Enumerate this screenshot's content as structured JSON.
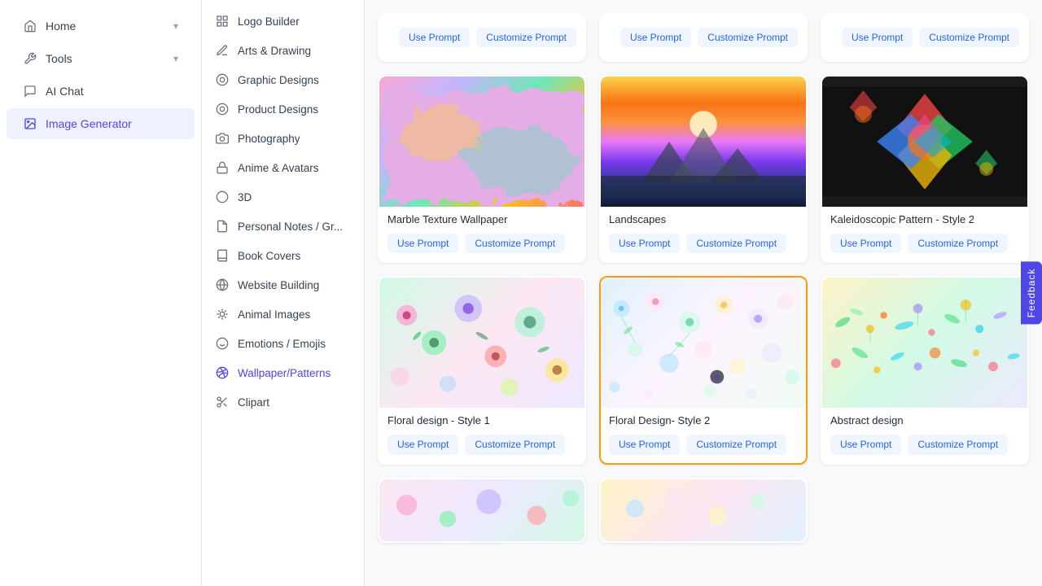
{
  "sidebar": {
    "items": [
      {
        "id": "home",
        "label": "Home",
        "icon": "home",
        "hasChevron": true,
        "active": false
      },
      {
        "id": "tools",
        "label": "Tools",
        "icon": "tools",
        "hasChevron": true,
        "active": false
      },
      {
        "id": "ai-chat",
        "label": "AI Chat",
        "icon": "chat",
        "hasChevron": false,
        "active": false
      },
      {
        "id": "image-generator",
        "label": "Image Generator",
        "icon": "image",
        "hasChevron": false,
        "active": true
      }
    ]
  },
  "categories": [
    {
      "id": "logo-builder",
      "label": "Logo Builder",
      "icon": "grid",
      "active": false
    },
    {
      "id": "arts-drawing",
      "label": "Arts & Drawing",
      "icon": "pencil",
      "active": false
    },
    {
      "id": "graphic-designs",
      "label": "Graphic Designs",
      "icon": "shapes",
      "active": false
    },
    {
      "id": "product-designs",
      "label": "Product Designs",
      "icon": "shapes",
      "active": false
    },
    {
      "id": "photography",
      "label": "Photography",
      "icon": "camera",
      "active": false
    },
    {
      "id": "anime-avatars",
      "label": "Anime & Avatars",
      "icon": "lock",
      "active": false
    },
    {
      "id": "3d",
      "label": "3D",
      "icon": "sphere",
      "active": false
    },
    {
      "id": "personal-notes",
      "label": "Personal Notes / Gr...",
      "icon": "note",
      "active": false
    },
    {
      "id": "book-covers",
      "label": "Book Covers",
      "icon": "book",
      "active": false
    },
    {
      "id": "website-building",
      "label": "Website Building",
      "icon": "globe",
      "active": false
    },
    {
      "id": "animal-images",
      "label": "Animal Images",
      "icon": "paw",
      "active": false
    },
    {
      "id": "emotions-emojis",
      "label": "Emotions / Emojis",
      "icon": "smile",
      "active": false
    },
    {
      "id": "wallpaper-patterns",
      "label": "Wallpaper/Patterns",
      "icon": "pattern",
      "active": true
    },
    {
      "id": "clipart",
      "label": "Clipart",
      "icon": "scissors",
      "active": false
    }
  ],
  "cards": [
    {
      "id": "card-top-1",
      "partial": true,
      "actions": {
        "use": "Use Prompt",
        "customize": "Customize Prompt"
      }
    },
    {
      "id": "card-top-2",
      "partial": true,
      "actions": {
        "use": "Use Prompt",
        "customize": "Customize Prompt"
      }
    },
    {
      "id": "card-top-3",
      "partial": true,
      "actions": {
        "use": "Use Prompt",
        "customize": "Customize Prompt"
      }
    },
    {
      "id": "marble",
      "title": "Marble Texture Wallpaper",
      "bg": "marble",
      "selected": false,
      "actions": {
        "use": "Use Prompt",
        "customize": "Customize Prompt"
      }
    },
    {
      "id": "landscapes",
      "title": "Landscapes",
      "bg": "landscape",
      "selected": false,
      "actions": {
        "use": "Use Prompt",
        "customize": "Customize Prompt"
      }
    },
    {
      "id": "kaleidoscope",
      "title": "Kaleidoscopic Pattern - Style 2",
      "bg": "kaleidoscope",
      "selected": false,
      "actions": {
        "use": "Use Prompt",
        "customize": "Customize Prompt"
      }
    },
    {
      "id": "floral1",
      "title": "Floral design - Style 1",
      "bg": "floral1",
      "selected": false,
      "actions": {
        "use": "Use Prompt",
        "customize": "Customize Prompt"
      }
    },
    {
      "id": "floral2",
      "title": "Floral Design- Style 2",
      "bg": "floral2",
      "selected": true,
      "actions": {
        "use": "Use Prompt",
        "customize": "Customize Prompt"
      }
    },
    {
      "id": "abstract",
      "title": "Abstract design",
      "bg": "abstract",
      "selected": false,
      "actions": {
        "use": "Use Prompt",
        "customize": "Customize Prompt"
      }
    }
  ],
  "bottom_cards": [
    {
      "id": "bottom1",
      "bg": "bottom1"
    },
    {
      "id": "bottom2",
      "bg": "bottom2"
    }
  ],
  "feedback": {
    "label": "Feedback"
  },
  "buttons": {
    "use_prompt": "Use Prompt",
    "customize_prompt": "Customize Prompt"
  }
}
